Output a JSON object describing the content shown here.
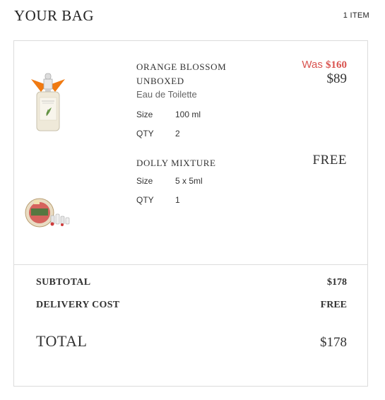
{
  "header": {
    "title": "YOUR BAG",
    "item_count": "1 ITEM"
  },
  "items": [
    {
      "name": "ORANGE BLOSSOM UNBOXED",
      "variant": "Eau de Toilette",
      "size_label": "Size",
      "size_value": "100 ml",
      "qty_label": "QTY",
      "qty_value": "2",
      "price_was_prefix": "Was ",
      "price_was": "$160",
      "price_now": "$89",
      "image_icon": "perfume-bottle-icon"
    },
    {
      "name": "DOLLY MIXTURE",
      "size_label": "Size",
      "size_value": "5 x 5ml",
      "qty_label": "QTY",
      "qty_value": "1",
      "price": "FREE",
      "image_icon": "gift-set-icon"
    }
  ],
  "summary": {
    "subtotal_label": "SUBTOTAL",
    "subtotal_value": "$178",
    "delivery_label": "DELIVERY COST",
    "delivery_value": "FREE",
    "total_label": "TOTAL",
    "total_value": "$178"
  },
  "colors": {
    "sale_red": "#d9534f",
    "border": "#dcdcdc",
    "text": "#333333"
  }
}
